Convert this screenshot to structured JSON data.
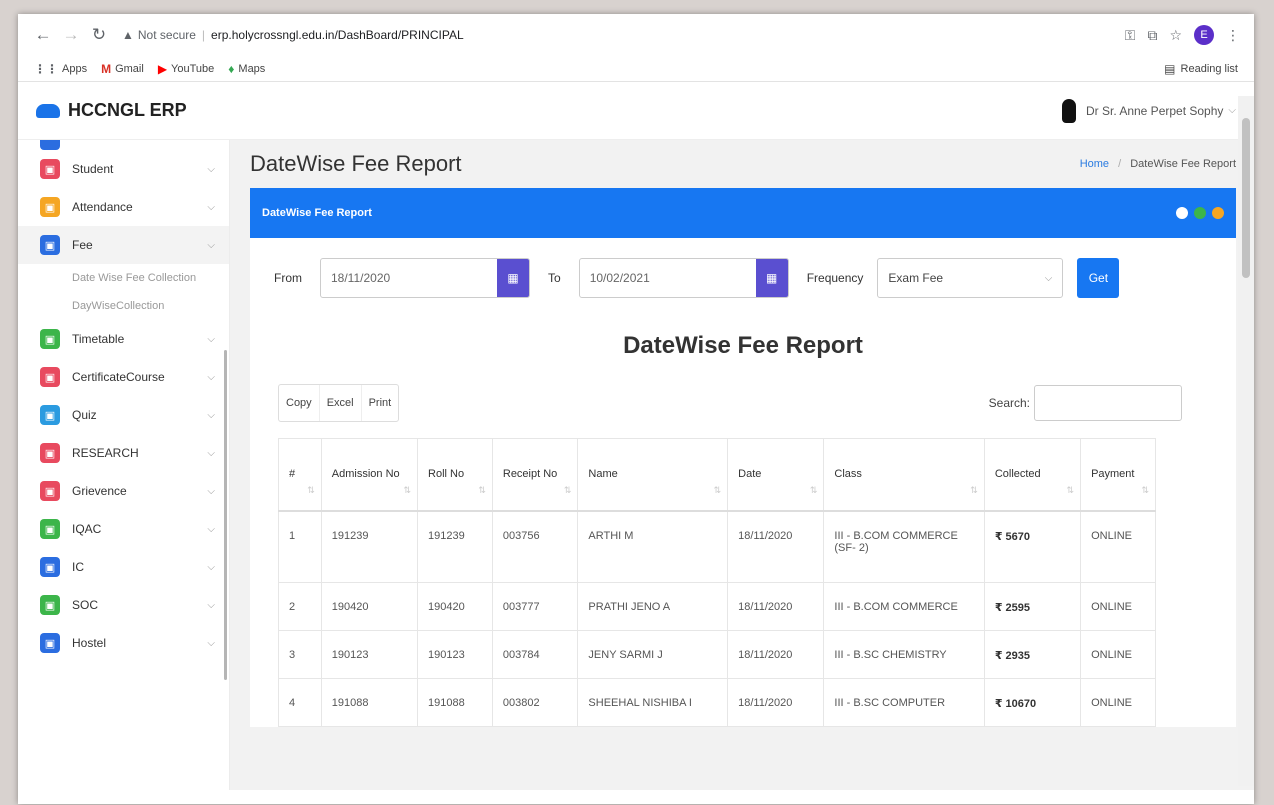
{
  "browser": {
    "not_secure": "Not secure",
    "url": "erp.holycrossngl.edu.in/DashBoard/PRINCIPAL",
    "profile_letter": "E",
    "bookmarks": [
      {
        "label": "Apps",
        "icon": "apps-grid-icon",
        "color": "#5f6368",
        "glyph": "⋮⋮"
      },
      {
        "label": "Gmail",
        "icon": "gmail-icon",
        "color": "#d93025",
        "glyph": "M"
      },
      {
        "label": "YouTube",
        "icon": "youtube-icon",
        "color": "#ff0000",
        "glyph": "▶"
      },
      {
        "label": "Maps",
        "icon": "maps-pin-icon",
        "color": "#34a853",
        "glyph": "♦"
      }
    ],
    "reading_list": "Reading list"
  },
  "app": {
    "logo": "HCCNGL ERP",
    "user_name": "Dr Sr. Anne Perpet Sophy"
  },
  "sidebar": {
    "items": [
      {
        "label": "Student",
        "color": "#e84a5f"
      },
      {
        "label": "Attendance",
        "color": "#f5a623"
      },
      {
        "label": "Fee",
        "color": "#2b6de0",
        "active": true
      }
    ],
    "sub_items": [
      "Date Wise Fee Collection",
      "DayWiseCollection"
    ],
    "items2": [
      {
        "label": "Timetable",
        "color": "#3cb54a"
      },
      {
        "label": "CertificateCourse",
        "color": "#e84a5f"
      },
      {
        "label": "Quiz",
        "color": "#2b9be0"
      },
      {
        "label": "RESEARCH",
        "color": "#e84a5f"
      },
      {
        "label": "Grievence",
        "color": "#e84a5f"
      },
      {
        "label": "IQAC",
        "color": "#3cb54a"
      },
      {
        "label": "IC",
        "color": "#2b6de0"
      },
      {
        "label": "SOC",
        "color": "#3cb54a"
      },
      {
        "label": "Hostel",
        "color": "#2b6de0"
      }
    ]
  },
  "page": {
    "title": "DateWise Fee Report",
    "breadcrumb_home": "Home",
    "breadcrumb_current": "DateWise Fee Report"
  },
  "card": {
    "header": "DateWise Fee Report",
    "tool_colors": [
      "#ffffff",
      "#3cb54a",
      "#f5a623"
    ]
  },
  "filters": {
    "from_label": "From",
    "from_value": "18/11/2020",
    "to_label": "To",
    "to_value": "10/02/2021",
    "frequency_label": "Frequency",
    "frequency_value": "Exam Fee",
    "get_label": "Get"
  },
  "report": {
    "title": "DateWise Fee Report",
    "buttons": [
      "Copy",
      "Excel",
      "Print"
    ],
    "search_label": "Search:",
    "columns": [
      "#",
      "Admission No",
      "Roll No",
      "Receipt No",
      "Name",
      "Date",
      "Class",
      "Collected",
      "Payment"
    ],
    "rows": [
      [
        "1",
        "191239",
        "191239",
        "003756",
        "ARTHI M",
        "18/11/2020",
        "III - B.COM COMMERCE (SF- 2)",
        "₹ 5670",
        "ONLINE"
      ],
      [
        "2",
        "190420",
        "190420",
        "003777",
        "PRATHI JENO A",
        "18/11/2020",
        "III - B.COM COMMERCE",
        "₹ 2595",
        "ONLINE"
      ],
      [
        "3",
        "190123",
        "190123",
        "003784",
        "JENY SARMI J",
        "18/11/2020",
        "III - B.SC CHEMISTRY",
        "₹ 2935",
        "ONLINE"
      ],
      [
        "4",
        "191088",
        "191088",
        "003802",
        "SHEEHAL NISHIBA I",
        "18/11/2020",
        "III - B.SC COMPUTER",
        "₹ 10670",
        "ONLINE"
      ]
    ]
  }
}
